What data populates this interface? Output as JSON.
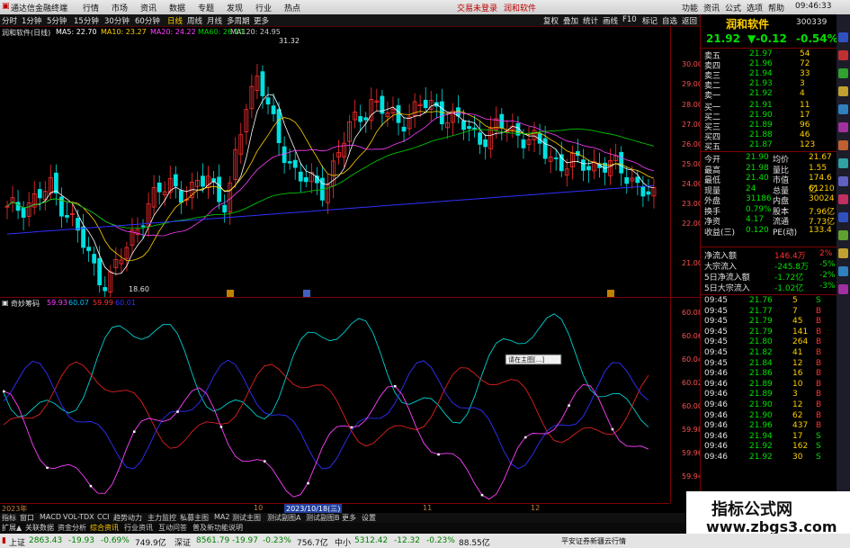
{
  "menu": {
    "app_title": "通达信金融终端",
    "items": [
      "行情",
      "市场",
      "资讯",
      "数据",
      "专题",
      "发现",
      "行业",
      "热点"
    ],
    "center_links": [
      "交易未登录",
      "润和软件"
    ],
    "right_items": [
      "功能",
      "资讯",
      "公式",
      "选项",
      "帮助"
    ],
    "time": "09:46:33"
  },
  "toolbar": {
    "periods": [
      "分时",
      "1分钟",
      "5分钟",
      "15分钟",
      "30分钟",
      "60分钟",
      "日线",
      "周线",
      "月线",
      "多周期",
      "更多"
    ],
    "selected": "日线",
    "right_buttons": [
      "复权",
      "叠加",
      "统计",
      "画线",
      "F10",
      "标记",
      "自选",
      "返回"
    ]
  },
  "info": {
    "title": "润和软件(日线)",
    "ma5": "MA5: 22.70",
    "ma10": "MA10: 23.27",
    "ma20": "MA20: 24.22",
    "ma60": "MA60: 26.10",
    "ma120": "MA120: 24.95",
    "max_label": "31.32",
    "min_label": "18.60"
  },
  "price_axis": [
    "30.00",
    "29.00",
    "28.00",
    "27.00",
    "26.00",
    "25.00",
    "24.00",
    "23.00",
    "22.00",
    "21.00"
  ],
  "sub": {
    "name": "奇妙筹码",
    "v1": "59.93",
    "v2": "60.07",
    "v3": "59.99",
    "v4": "60.01",
    "axis": [
      "60.08",
      "60.06",
      "60.04",
      "60.02",
      "60.00",
      "59.98",
      "59.96",
      "59.94"
    ],
    "tooltip": "请在主图[...]",
    "date_label": "2023/10/18(三)",
    "year_label": "2023年",
    "markers": [
      "10",
      "11",
      "12"
    ]
  },
  "stock": {
    "name": "润和软件",
    "code": "300339",
    "price": "21.92",
    "change": "▼-0.12",
    "pct": "-0.54%"
  },
  "asks": [
    {
      "label": "卖五",
      "price": "21.97",
      "vol": "54"
    },
    {
      "label": "卖四",
      "price": "21.96",
      "vol": "72"
    },
    {
      "label": "卖三",
      "price": "21.94",
      "vol": "33"
    },
    {
      "label": "卖二",
      "price": "21.93",
      "vol": "3"
    },
    {
      "label": "卖一",
      "price": "21.92",
      "vol": "4"
    }
  ],
  "bids": [
    {
      "label": "买一",
      "price": "21.91",
      "vol": "11"
    },
    {
      "label": "买二",
      "price": "21.90",
      "vol": "17"
    },
    {
      "label": "买三",
      "price": "21.89",
      "vol": "96"
    },
    {
      "label": "买四",
      "price": "21.88",
      "vol": "46"
    },
    {
      "label": "买五",
      "price": "21.87",
      "vol": "123"
    }
  ],
  "quote": [
    {
      "l1": "今开",
      "v1": "21.90",
      "l2": "均价",
      "v2": "21.67"
    },
    {
      "l1": "最高",
      "v1": "21.98",
      "l2": "量比",
      "v2": "1.55"
    },
    {
      "l1": "最低",
      "v1": "21.40",
      "l2": "市值",
      "v2": "174.6亿"
    },
    {
      "l1": "现量",
      "v1": "24",
      "l2": "总量",
      "v2": "61210"
    },
    {
      "l1": "外盘",
      "v1": "31186",
      "l2": "内盘",
      "v2": "30024"
    },
    {
      "l1": "换手",
      "v1": "0.79%",
      "l2": "股本",
      "v2": "7.96亿"
    },
    {
      "l1": "净资",
      "v1": "4.17",
      "l2": "流通",
      "v2": "7.73亿"
    },
    {
      "l1": "收益(三)",
      "v1": "0.120",
      "l2": "PE(动)",
      "v2": "133.4"
    }
  ],
  "flows": [
    {
      "label": "净流入额",
      "value": "146.4万",
      "pct": "2%"
    },
    {
      "label": "大宗流入",
      "value": "-245.8万",
      "pct": "-5%"
    },
    {
      "label": "5日净流入额",
      "value": "-1.72亿",
      "pct": "-2%"
    },
    {
      "label": "5日大宗流入",
      "value": "-1.02亿",
      "pct": "-3%"
    }
  ],
  "ticks": [
    {
      "t": "09:45",
      "p": "21.76",
      "v": "5",
      "s": "S"
    },
    {
      "t": "09:45",
      "p": "21.77",
      "v": "7",
      "s": "B"
    },
    {
      "t": "09:45",
      "p": "21.79",
      "v": "45",
      "s": "B"
    },
    {
      "t": "09:45",
      "p": "21.79",
      "v": "141",
      "s": "B"
    },
    {
      "t": "09:45",
      "p": "21.80",
      "v": "264",
      "s": "B"
    },
    {
      "t": "09:45",
      "p": "21.82",
      "v": "41",
      "s": "B"
    },
    {
      "t": "09:45",
      "p": "21.84",
      "v": "12",
      "s": "B"
    },
    {
      "t": "09:46",
      "p": "21.86",
      "v": "16",
      "s": "B"
    },
    {
      "t": "09:46",
      "p": "21.89",
      "v": "10",
      "s": "B"
    },
    {
      "t": "09:46",
      "p": "21.89",
      "v": "3",
      "s": "B"
    },
    {
      "t": "09:46",
      "p": "21.90",
      "v": "12",
      "s": "B"
    },
    {
      "t": "09:46",
      "p": "21.90",
      "v": "62",
      "s": "B"
    },
    {
      "t": "09:46",
      "p": "21.96",
      "v": "437",
      "s": "B"
    },
    {
      "t": "09:46",
      "p": "21.94",
      "v": "17",
      "s": "S"
    },
    {
      "t": "09:46",
      "p": "21.92",
      "v": "162",
      "s": "S"
    },
    {
      "t": "09:46",
      "p": "21.92",
      "v": "30",
      "s": "S"
    }
  ],
  "bottom_tabs": [
    "指标",
    "窗口",
    "MACD",
    "VOL-TDX",
    "CCI",
    "趋势动力",
    "主力监控",
    "私募主图",
    "MA2",
    "测试主图",
    "测试副图A",
    "测试副图B",
    "更多",
    "设置"
  ],
  "bottom_tabs2": [
    "扩展▲",
    "关联数据",
    "资金分析",
    "综合资讯",
    "行业资讯",
    "互动问答",
    "普及新功能说明"
  ],
  "status": {
    "sh_label": "上证",
    "sh_value": "2863.43",
    "sh_change": "-19.93",
    "sh_pct": "-0.69%",
    "sh_amount": "749.9亿",
    "sz_label": "深证",
    "sz_value": "8561.79",
    "sz_change": "-19.97",
    "sz_pct": "-0.23%",
    "sz_amount": "756.7亿",
    "zx_label": "中小",
    "zx_value": "5312.42",
    "zx_change": "-12.32",
    "zx_pct": "-0.23%",
    "zx_amount": "88.55亿",
    "broker": "平安证券新疆云行情"
  },
  "watermark": {
    "line1": "指标公式网",
    "line2": "www.zbgs3.com"
  },
  "colors": {
    "up": "#ff3030",
    "down": "#00e0e0",
    "bg": "#000000",
    "yellow": "#ffd000",
    "green": "#00d000"
  }
}
